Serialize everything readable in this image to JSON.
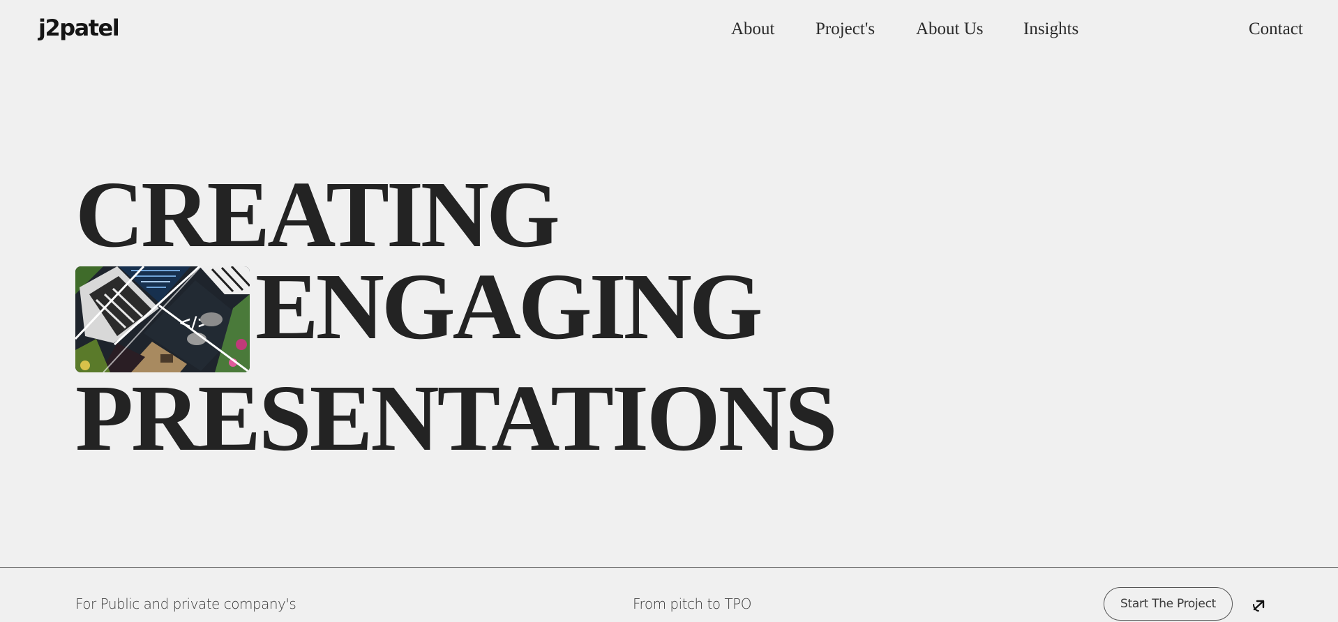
{
  "header": {
    "logo": "j2patel",
    "nav": [
      "About",
      "Project's",
      "About Us",
      "Insights"
    ],
    "contact": "Contact"
  },
  "hero": {
    "line1": "CREATING",
    "line2": "ENGAGING",
    "line3": "PRESENTATIONS"
  },
  "footer": {
    "left_text": "For Public and private company's",
    "middle_text": "From pitch to TPO",
    "cta_label": "Start The Project",
    "cta_icon": "arrow-up-right-icon"
  },
  "colors": {
    "background": "#f0f0f0",
    "text": "#222222",
    "border": "#555555"
  }
}
